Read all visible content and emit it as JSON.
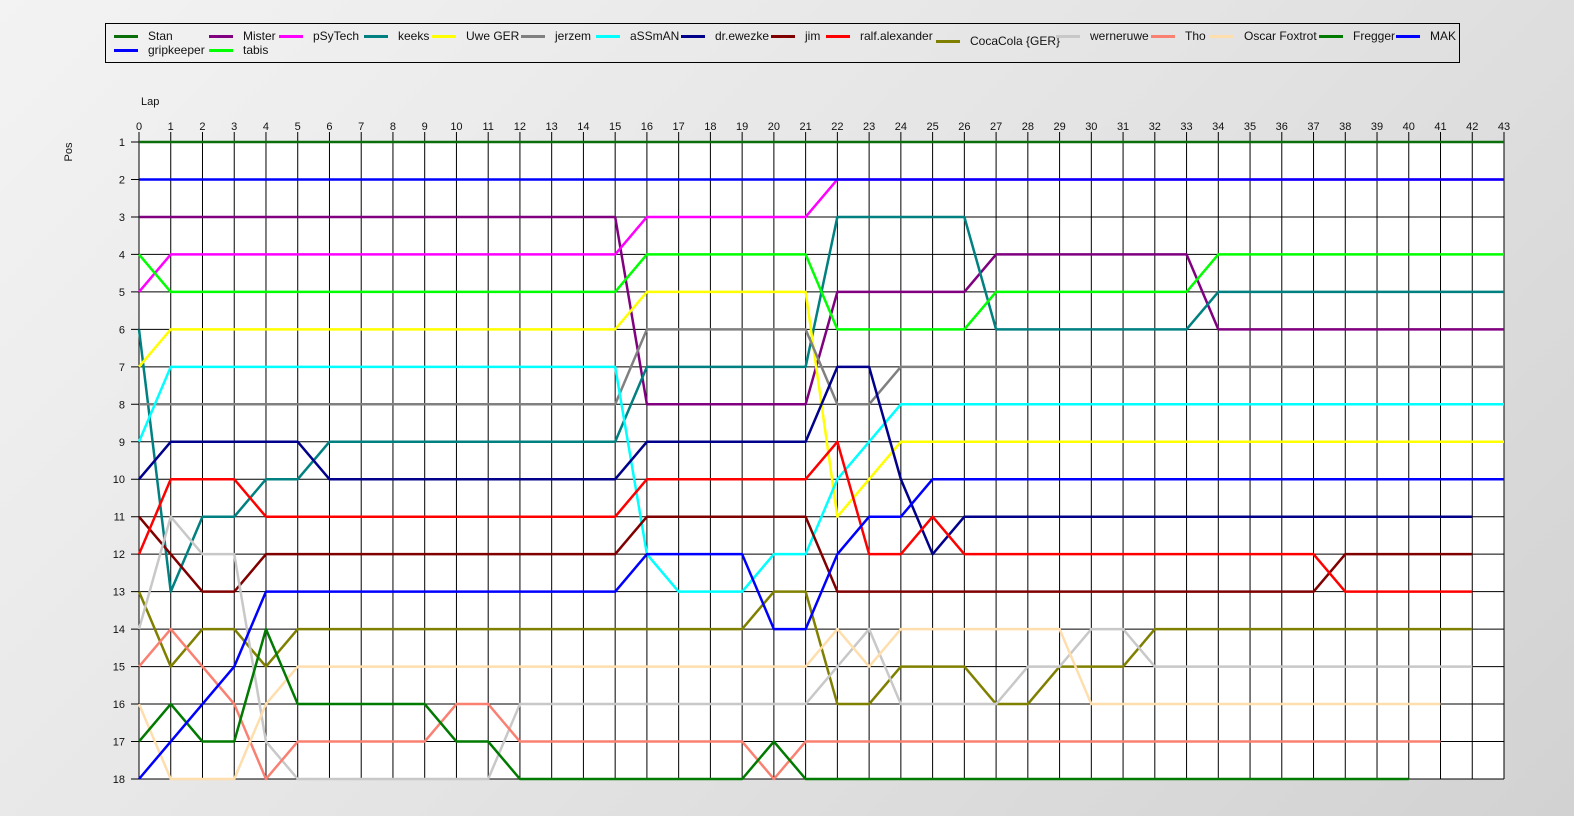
{
  "chart_data": {
    "type": "line",
    "xlabel": "Lap",
    "ylabel": "Pos",
    "x_ticks": [
      0,
      1,
      2,
      3,
      4,
      5,
      6,
      7,
      8,
      9,
      10,
      11,
      12,
      13,
      14,
      15,
      16,
      17,
      18,
      19,
      20,
      21,
      22,
      23,
      24,
      25,
      26,
      27,
      28,
      29,
      30,
      31,
      32,
      33,
      34,
      35,
      36,
      37,
      38,
      39,
      40,
      41,
      42,
      43
    ],
    "y_ticks": [
      1,
      2,
      3,
      4,
      5,
      6,
      7,
      8,
      9,
      10,
      11,
      12,
      13,
      14,
      15,
      16,
      17,
      18
    ],
    "xlim": [
      0,
      43
    ],
    "ylim": [
      1,
      18
    ],
    "y_inverted": true,
    "grid": true,
    "legend_position": "top",
    "series": [
      {
        "name": "Stan",
        "color": "#0a6e0a",
        "x": [
          0,
          43
        ],
        "y": [
          1,
          1
        ]
      },
      {
        "name": "Mister",
        "color": "#800080",
        "x": [
          0,
          15,
          16,
          21,
          22,
          26,
          27,
          33,
          34,
          42,
          43
        ],
        "y": [
          3,
          3,
          8,
          8,
          5,
          5,
          4,
          4,
          6,
          6,
          6
        ]
      },
      {
        "name": "pSyTech",
        "color": "#ff00ff",
        "x": [
          0,
          1,
          15,
          16,
          21,
          22,
          43
        ],
        "y": [
          5,
          4,
          4,
          3,
          3,
          2,
          2
        ]
      },
      {
        "name": "keeks",
        "color": "#008080",
        "x": [
          0,
          1,
          2,
          3,
          4,
          5,
          6,
          15,
          16,
          21,
          22,
          26,
          27,
          33,
          34,
          43
        ],
        "y": [
          6,
          13,
          11,
          11,
          10,
          10,
          9,
          9,
          7,
          7,
          3,
          3,
          6,
          6,
          5,
          5
        ]
      },
      {
        "name": "Uwe GER",
        "color": "#ffff00",
        "x": [
          0,
          1,
          15,
          16,
          21,
          22,
          23,
          24,
          43
        ],
        "y": [
          7,
          6,
          6,
          5,
          5,
          11,
          10,
          9,
          9
        ]
      },
      {
        "name": "jerzem",
        "color": "#808080",
        "x": [
          0,
          15,
          16,
          21,
          22,
          23,
          24,
          43
        ],
        "y": [
          8,
          8,
          6,
          6,
          8,
          8,
          7,
          7
        ]
      },
      {
        "name": "aSSmAN",
        "color": "#00ffff",
        "x": [
          0,
          1,
          15,
          16,
          17,
          19,
          20,
          21,
          22,
          23,
          24,
          43
        ],
        "y": [
          9,
          7,
          7,
          12,
          13,
          13,
          12,
          12,
          10,
          9,
          8,
          8
        ]
      },
      {
        "name": "dr.ewezke",
        "color": "#00008b",
        "x": [
          0,
          1,
          5,
          6,
          15,
          16,
          21,
          22,
          23,
          24,
          25,
          26,
          42
        ],
        "y": [
          10,
          9,
          9,
          10,
          10,
          9,
          9,
          7,
          7,
          10,
          12,
          11,
          11
        ]
      },
      {
        "name": "jim",
        "color": "#800000",
        "x": [
          0,
          2,
          3,
          4,
          15,
          16,
          21,
          22,
          37,
          38,
          42
        ],
        "y": [
          11,
          13,
          13,
          12,
          12,
          11,
          11,
          13,
          13,
          12,
          12
        ]
      },
      {
        "name": "ralf.alexander",
        "color": "#ff0000",
        "x": [
          0,
          1,
          3,
          4,
          15,
          16,
          21,
          22,
          23,
          24,
          25,
          26,
          37,
          38,
          42
        ],
        "y": [
          12,
          10,
          10,
          11,
          11,
          10,
          10,
          9,
          12,
          12,
          11,
          12,
          12,
          13,
          13
        ]
      },
      {
        "name": "CocaCola {GER}",
        "color": "#808000",
        "x": [
          0,
          1,
          2,
          3,
          4,
          5,
          19,
          20,
          21,
          22,
          23,
          24,
          26,
          27,
          28,
          29,
          30,
          31,
          32,
          42
        ],
        "y": [
          13,
          15,
          14,
          14,
          15,
          14,
          14,
          13,
          13,
          16,
          16,
          15,
          15,
          16,
          16,
          15,
          15,
          15,
          14,
          14
        ]
      },
      {
        "name": "werneruwe",
        "color": "#c8c8c8",
        "x": [
          0,
          1,
          2,
          3,
          4,
          5,
          11,
          12,
          21,
          22,
          23,
          24,
          26,
          27,
          28,
          29,
          30,
          31,
          32,
          42
        ],
        "y": [
          14,
          11,
          12,
          12,
          17,
          18,
          18,
          16,
          16,
          15,
          14,
          16,
          16,
          16,
          15,
          15,
          14,
          14,
          15,
          15
        ]
      },
      {
        "name": "Tho",
        "color": "#fa8072",
        "x": [
          0,
          1,
          2,
          3,
          4,
          5,
          9,
          10,
          11,
          12,
          19,
          20,
          21,
          41
        ],
        "y": [
          15,
          14,
          15,
          16,
          18,
          17,
          17,
          16,
          16,
          17,
          17,
          18,
          17,
          17
        ]
      },
      {
        "name": "Oscar Foxtrot",
        "color": "#ffdead",
        "x": [
          0,
          1,
          3,
          4,
          5,
          21,
          22,
          23,
          24,
          29,
          30,
          41
        ],
        "y": [
          16,
          18,
          18,
          16,
          15,
          15,
          14,
          15,
          14,
          14,
          16,
          16
        ]
      },
      {
        "name": "Fregger",
        "color": "#007a00",
        "x": [
          0,
          1,
          2,
          3,
          4,
          5,
          9,
          10,
          11,
          12,
          19,
          20,
          21,
          40
        ],
        "y": [
          17,
          16,
          17,
          17,
          14,
          16,
          16,
          17,
          17,
          18,
          18,
          17,
          18,
          18
        ]
      },
      {
        "name": "MAK",
        "color": "#0000ff",
        "x": [
          0,
          1,
          15,
          16,
          21,
          43
        ],
        "y": [
          2,
          2,
          2,
          2,
          2,
          2
        ]
      },
      {
        "name": "gripkeeper",
        "color": "#0000ff",
        "x": [
          0,
          1,
          2,
          3,
          4,
          15,
          16,
          17,
          19,
          20,
          21,
          22,
          23,
          24,
          25,
          43
        ],
        "y": [
          18,
          17,
          16,
          15,
          13,
          13,
          12,
          12,
          12,
          14,
          14,
          12,
          11,
          11,
          10,
          10
        ]
      },
      {
        "name": "tabis",
        "color": "#00ff00",
        "x": [
          0,
          1,
          15,
          16,
          21,
          22,
          26,
          27,
          33,
          34,
          43
        ],
        "y": [
          4,
          5,
          5,
          4,
          4,
          6,
          6,
          5,
          5,
          4,
          4
        ]
      }
    ],
    "legend_order": [
      "Stan",
      "Mister",
      "pSyTech",
      "keeks",
      "Uwe GER",
      "jerzem",
      "aSSmAN",
      "dr.ewezke",
      "jim",
      "ralf.alexander",
      "CocaCola {GER}",
      "werneruwe",
      "Tho",
      "Oscar Foxtrot",
      "Fregger",
      "MAK",
      "gripkeeper",
      "tabis"
    ]
  }
}
